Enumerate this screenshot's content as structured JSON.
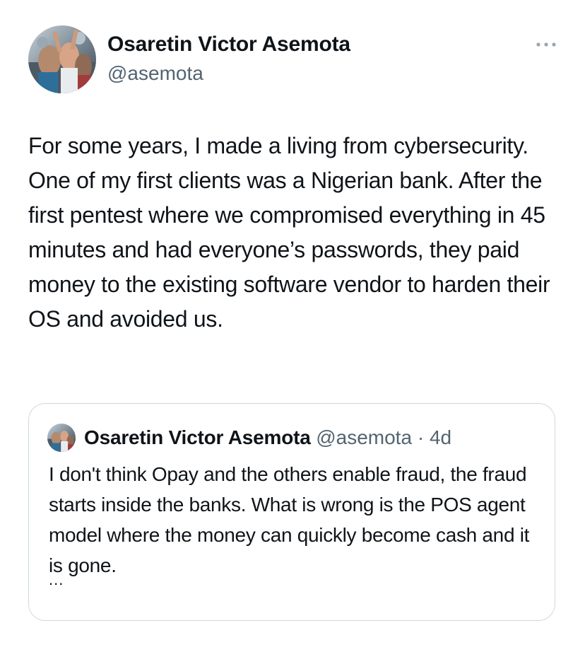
{
  "tweet": {
    "author": {
      "name": "Osaretin Victor Asemota",
      "handle": "@asemota",
      "avatar_icon": "profile-photo-crowd"
    },
    "more_icon": "ellipsis-icon",
    "text": "For some years, I made a living from cybersecurity. One of my first clients was a Nigerian bank. After the first pentest where we compromised everything in 45 minutes and had everyone’s passwords, they paid money to the existing software vendor to harden their OS and avoided us."
  },
  "quoted_tweet": {
    "author": {
      "name": "Osaretin Victor Asemota",
      "handle": "@asemota",
      "avatar_icon": "profile-photo-crowd"
    },
    "separator": "·",
    "time": "4d",
    "text": "I don't think Opay and the others enable fraud, the fraud starts inside the banks. What is wrong is the POS agent model where the money can quickly become cash and it is gone.",
    "truncation": "..."
  },
  "colors": {
    "text_primary": "#0f1419",
    "text_secondary": "#536471",
    "border": "#cfd9de"
  }
}
